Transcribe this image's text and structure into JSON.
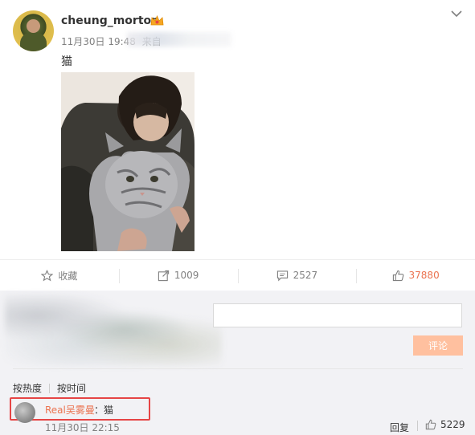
{
  "post": {
    "username": "cheung_morton",
    "time": "11月30日 19:48",
    "via_prefix": "来自",
    "text": "猫",
    "vip_icon": "vip-crown-icon",
    "menu_icon": "chevron-down-icon"
  },
  "actions": {
    "favorite_label": "收藏",
    "repost_count": "1009",
    "comment_count": "2527",
    "like_count": "37880"
  },
  "composer": {
    "submit_label": "评论"
  },
  "sort": {
    "hot_label": "按热度",
    "time_label": "按时间"
  },
  "comment": {
    "author": "Real吴雾曼",
    "text": "：猫",
    "time": "11月30日 22:15",
    "reply_label": "回复",
    "like_count": "5229"
  },
  "colors": {
    "accent": "#eb7350",
    "submit_bg": "#ffc09f",
    "highlight": "#e64545"
  }
}
